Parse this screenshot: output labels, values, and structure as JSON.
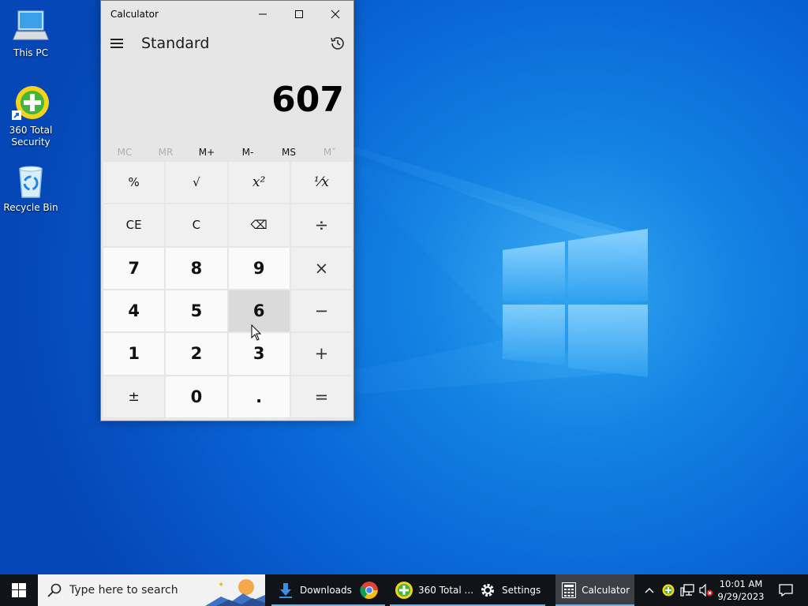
{
  "desktop": {
    "icons": [
      {
        "label_lines": [
          "This PC"
        ],
        "icon": "this-pc-icon"
      },
      {
        "label_lines": [
          "360 Total",
          "Security"
        ],
        "icon": "360-total-security-icon"
      },
      {
        "label_lines": [
          "Recycle Bin"
        ],
        "icon": "recycle-bin-icon"
      }
    ]
  },
  "calculator": {
    "window_title": "Calculator",
    "mode": "Standard",
    "display_value": "607",
    "memory_buttons": [
      {
        "label": "MC",
        "enabled": false
      },
      {
        "label": "MR",
        "enabled": false
      },
      {
        "label": "M+",
        "enabled": true
      },
      {
        "label": "M-",
        "enabled": true
      },
      {
        "label": "MS",
        "enabled": true
      },
      {
        "label": "M˅",
        "enabled": false
      }
    ],
    "keys": {
      "percent": "%",
      "sqrt": "√",
      "square": "x²",
      "reciprocal": "⅟x",
      "ce": "CE",
      "c": "C",
      "backspace": "⌫",
      "divide": "÷",
      "seven": "7",
      "eight": "8",
      "nine": "9",
      "multiply": "×",
      "four": "4",
      "five": "5",
      "six": "6",
      "minus": "−",
      "one": "1",
      "two": "2",
      "three": "3",
      "plus": "+",
      "negate": "±",
      "zero": "0",
      "decimal": ".",
      "equals": "="
    }
  },
  "taskbar": {
    "search_placeholder": "Type here to search",
    "apps": [
      {
        "label": "Downloads",
        "icon": "downloads-folder-icon"
      },
      {
        "label": "",
        "icon": "chrome-icon"
      },
      {
        "label": "360 Total ...",
        "icon": "360-total-security-icon"
      },
      {
        "label": "Settings",
        "icon": "gear-icon"
      },
      {
        "label": "Calculator",
        "icon": "calculator-icon",
        "active": true
      }
    ],
    "clock_time": "10:01 AM",
    "clock_date": "9/29/2023"
  },
  "colors": {
    "desktop_blue": "#0a6ad8",
    "taskbar": "#101418",
    "calc_bg": "#e6e6e6",
    "number_key": "#fafafa",
    "function_key": "#f0f0f0",
    "active_task_underline": "#7aaed6"
  }
}
